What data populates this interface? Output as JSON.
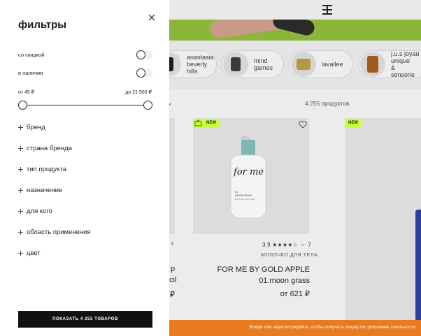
{
  "filters": {
    "title": "фильтры",
    "discount_label": "со скидкой",
    "in_stock_label": "в наличии",
    "price_from_label": "от 45 ₽",
    "price_to_label": "до 21 500 ₽",
    "facets": [
      "бренд",
      "страна бренда",
      "тип продукта",
      "назначение",
      "для кого",
      "область применения",
      "цвет"
    ],
    "show_button": "ПОКАЗАТЬ 4 255 ТОВАРОВ"
  },
  "brands": [
    "anastasia\nbeverly\nhills",
    "mind\ngames",
    "lavallee",
    "j.u.s joyau\nunique\n& sensorie"
  ],
  "catalog": {
    "count": "4 255 продуктов",
    "badge_new": "NEW",
    "product": {
      "rating": "3.9",
      "stars_filled": 4,
      "stars_total": 5,
      "reviews": "7",
      "category": "МОЛОЧКО ДЛЯ ТЕЛА",
      "name": "FOR ME BY GOLD APPLE 01.moon grass",
      "price": "от 621 ₽"
    },
    "left_partial": {
      "rating_tail": "3",
      "line1": "p",
      "line2": "cil",
      "price_tail": "₽"
    }
  },
  "product_label": {
    "brand_script": "for me",
    "line1": "01",
    "line2": "MOON GRASS",
    "line3": "молочко для тела"
  },
  "promo": {
    "text": "Войди или зарегистрируйся, чтобы получить скидку по программе лояльности"
  },
  "colors": {
    "accent_green": "#c8ff3c",
    "banner_green": "#8ab73a",
    "promo_orange": "#e87a1f"
  }
}
